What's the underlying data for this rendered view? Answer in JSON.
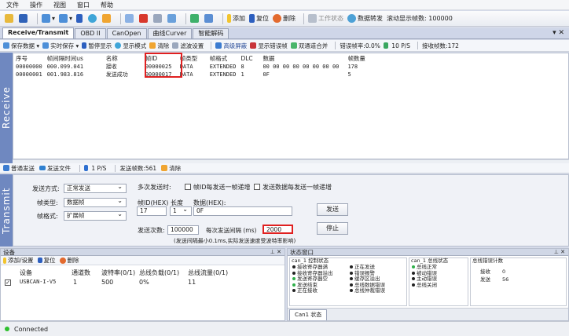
{
  "menu": [
    "文件",
    "操作",
    "视图",
    "窗口",
    "帮助"
  ],
  "toolbar": {
    "save_data": "保存数据",
    "realtime_save": "实时保存",
    "pause_display": "暂停显示",
    "display_mode": "显示模式",
    "clear": "清除",
    "filter_settings": "滤波设置",
    "add": "添加",
    "reset": "复位",
    "remove": "删除",
    "work_state": "工作状态",
    "data_forward": "数据转发",
    "scroll_label": "滚动显示帧数:",
    "scroll_value": "100000"
  },
  "tabs": [
    "Receive/Transmit",
    "OBD II",
    "CanOpen",
    "曲线Curver",
    "智能解码"
  ],
  "rx_toolbar": {
    "save_data": "保存数据",
    "realtime_save": "实时保存",
    "pause_display": "暂停显示",
    "display_mode": "显示模式",
    "clear": "清除",
    "filter_settings": "滤波设置",
    "advanced_screen": "高级屏蔽",
    "show_error_frames": "显示错误帧",
    "dual_channel_merge": "双通道合并",
    "error_rate": "错误帧率:0.0%",
    "fps": "10 P/S",
    "rx_count": "接收帧数:172"
  },
  "receive_label": "Receive",
  "transmit_label": "Transmit",
  "table": {
    "headers": [
      "序号",
      "帧间隔时间us",
      "名称",
      "帧ID",
      "帧类型",
      "帧格式",
      "DLC",
      "数据",
      "帧数量"
    ],
    "rows": [
      [
        "00000000",
        "000.099.041",
        "接收",
        "00000025",
        "DATA",
        "EXTENDED",
        "8",
        "00 00 00 00 00 00 00 00",
        "178"
      ],
      [
        "00000001",
        "001.983.816",
        "发送成功",
        "00000017",
        "DATA",
        "EXTENDED",
        "1",
        "0F",
        "5"
      ]
    ]
  },
  "tx_toolbar": {
    "normal_send": "普通发送",
    "file_send": "发送文件",
    "rate": "1 P/S",
    "sent_count": "发送帧数:561",
    "clear": "清除"
  },
  "tx": {
    "send_mode_label": "发送方式:",
    "send_mode": "正常发送",
    "frame_type_label": "帧类型:",
    "frame_type": "数据帧",
    "frame_format_label": "帧格式:",
    "frame_format": "扩展帧",
    "send_per_label": "多次发送时:",
    "id_inc": "帧ID每发送一帧递增",
    "data_inc": "发送数据每发送一帧递增",
    "id_label": "帧ID(HEX)",
    "len_label": "长度",
    "data_label": "数据(HEX):",
    "id_value": "17",
    "len_value": "1",
    "data_value": "0F",
    "send_button": "发送",
    "count_label": "发送次数:",
    "count_value": "100000",
    "interval_label": "每次发送间隔 (ms)",
    "interval_value": "2000",
    "stop_button": "停止",
    "note": "(发送间隔最小0.1ms,实际发送速度受波特率影响)"
  },
  "device": {
    "title": "设备",
    "add": "添加/设置",
    "reset": "复位",
    "remove": "删除",
    "headers": [
      "设备",
      "通道数",
      "波特率(0/1)",
      "总线负载(0/1)",
      "总线流量(0/1)"
    ],
    "row": [
      "USBCAN-I-V5",
      "1",
      "500",
      "0%",
      "11"
    ]
  },
  "status_panel": {
    "title": "状态窗口",
    "ctrl_title": "can_1 控制状态",
    "bus_title": "can_1 总线状态",
    "err_title": "总线错误计数",
    "ctrl_left": [
      "接收寄存器满",
      "接收寄存器溢出",
      "发送寄存器空",
      "发送结束",
      "正在接收"
    ],
    "ctrl_right": [
      "正在发送",
      "错误报警",
      "缓存区溢出",
      "总线数据错误",
      "总线仲裁错误"
    ],
    "bus": [
      "总线正常",
      "被动错误",
      "主动错误",
      "总线关闭"
    ],
    "rx_label": "接收",
    "rx_value": "0",
    "tx_label": "发送",
    "tx_value": "56",
    "tab": "Can1 状态"
  },
  "status": {
    "text": "Connected",
    "color": "#2fc02f"
  }
}
